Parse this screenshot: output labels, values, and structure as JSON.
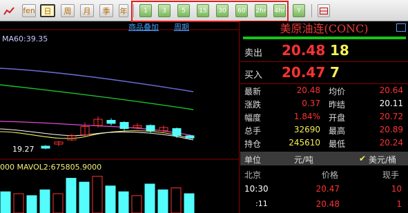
{
  "toolbar": {
    "buttons": [
      "fen",
      "日",
      "周",
      "月",
      "季",
      "年"
    ],
    "periods": [
      "1",
      "3",
      "5",
      "15",
      "30",
      "60",
      "2hr",
      "4hr",
      "Y"
    ]
  },
  "chart": {
    "links": [
      "商品叠加",
      "周期"
    ],
    "ma_label": "MA60:39.35",
    "low_label": "19.27",
    "vol_label": "000  MAVOL2:675805.9000",
    "candles": [
      {
        "o": 19.3,
        "c": 19.2,
        "h": 19.35,
        "l": 19.15
      },
      {
        "o": 19.4,
        "c": 19.5,
        "h": 19.55,
        "l": 19.3
      },
      {
        "o": 19.6,
        "c": 19.8,
        "h": 19.9,
        "l": 19.55
      },
      {
        "o": 19.85,
        "c": 20.25,
        "h": 20.45,
        "l": 19.8
      },
      {
        "o": 20.3,
        "c": 20.6,
        "h": 20.75,
        "l": 20.2
      },
      {
        "o": 20.55,
        "c": 20.4,
        "h": 20.65,
        "l": 20.3
      },
      {
        "o": 20.45,
        "c": 20.15,
        "h": 20.5,
        "l": 20.05
      },
      {
        "o": 20.2,
        "c": 20.3,
        "h": 20.4,
        "l": 20.1
      },
      {
        "o": 20.3,
        "c": 20.05,
        "h": 20.35,
        "l": 19.95
      },
      {
        "o": 20.05,
        "c": 20.2,
        "h": 20.3,
        "l": 19.95
      },
      {
        "o": 20.15,
        "c": 19.8,
        "h": 20.2,
        "l": 19.7
      },
      {
        "o": 19.8,
        "c": 19.7,
        "h": 19.85,
        "l": 19.6
      }
    ],
    "volumes": [
      0.55,
      0.5,
      0.45,
      0.6,
      0.5,
      0.9,
      0.8,
      0.95,
      0.7,
      0.55,
      0.45,
      0.75,
      0.6,
      0.65,
      0.5
    ]
  },
  "panel": {
    "title": "美原油连(CONC)",
    "sell": {
      "label": "卖出",
      "price": "20.48",
      "vol": "18"
    },
    "buy": {
      "label": "买入",
      "price": "20.47",
      "vol": "7"
    },
    "stats": [
      {
        "l1": "最新",
        "v1": "20.48",
        "c1": "red",
        "l2": "均价",
        "v2": "20.64",
        "c2": "red"
      },
      {
        "l1": "涨跌",
        "v1": "0.37",
        "c1": "red",
        "l2": "昨结",
        "v2": "20.11",
        "c2": "wht"
      },
      {
        "l1": "幅度",
        "v1": "1.84%",
        "c1": "red",
        "l2": "开盘",
        "v2": "20.72",
        "c2": "red"
      },
      {
        "l1": "总手",
        "v1": "32690",
        "c1": "yel",
        "l2": "最高",
        "v2": "20.89",
        "c2": "red"
      },
      {
        "l1": "持仓",
        "v1": "245610",
        "c1": "yel",
        "l2": "最低",
        "v2": "20.24",
        "c2": "red"
      }
    ],
    "unit": {
      "label": "单位",
      "value": "元/吨",
      "check": "✔",
      "alt": "美元/桶"
    },
    "ticks_header": {
      "place": "北京",
      "price": "价格",
      "hand": "现手"
    },
    "ticks": [
      {
        "time": "10:30",
        "price": "20.47",
        "hand": "10"
      },
      {
        "time": ":11",
        "price": "20.48",
        "hand": "1"
      }
    ]
  },
  "colors": {
    "up": "#ff3232",
    "down": "#54fcfc",
    "ma_blue": "#6a6ad8",
    "ma_green": "#1fbf2d",
    "ma_pink": "#e04ad0",
    "ma_yellow": "#f0f060"
  }
}
